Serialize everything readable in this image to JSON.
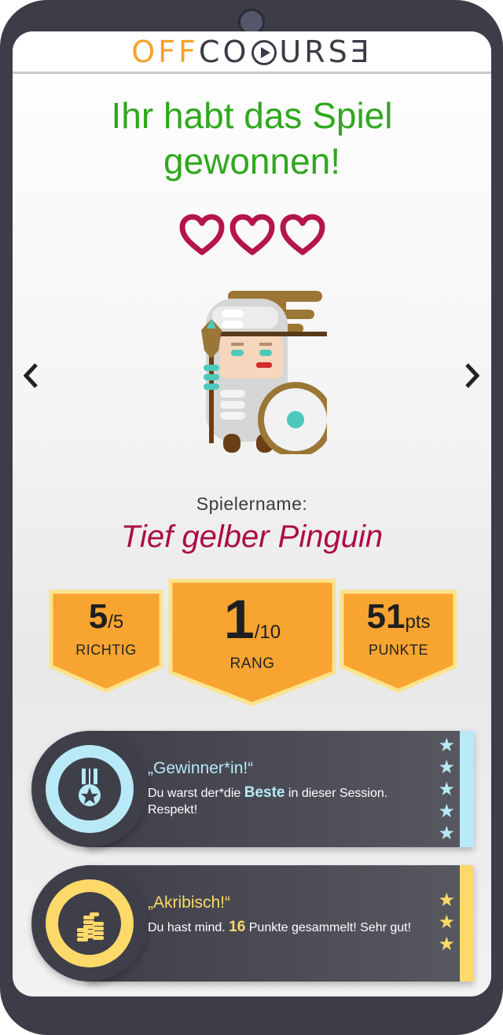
{
  "header": {
    "logo_off": "OFF",
    "logo_course": "URSƎ",
    "logo_c": "C"
  },
  "result": {
    "title_line1": "Ihr habt das Spiel",
    "title_line2": "gewonnen!",
    "hearts": 3,
    "heart_color": "#b5154b"
  },
  "player": {
    "name_label": "Spielername:",
    "name": "Tief gelber Pinguin",
    "avatar": "warrior-with-spear-and-shield"
  },
  "stats": {
    "correct": {
      "value": "5",
      "total": "/5",
      "label": "RICHTIG"
    },
    "rank": {
      "value": "1",
      "total": "/10",
      "label": "RANG"
    },
    "points": {
      "value": "51",
      "unit": "pts",
      "label": "PUNKTE"
    },
    "color": "#f8a431",
    "border_color": "#fbe38d"
  },
  "badges": [
    {
      "title": "„Gewinner*in!“",
      "text_before": "Du warst der*die ",
      "highlight": "Beste",
      "text_after": " in dieser Session. Respekt!",
      "icon": "medal-icon",
      "stars": 5,
      "accent": "#b8e9f7"
    },
    {
      "title": "„Akribisch!“",
      "text_before": "Du hast mind. ",
      "highlight": "16",
      "text_after": " Punkte gesammelt! Sehr gut!",
      "icon": "coins-icon",
      "stars": 3,
      "accent": "#fdd96a"
    }
  ]
}
